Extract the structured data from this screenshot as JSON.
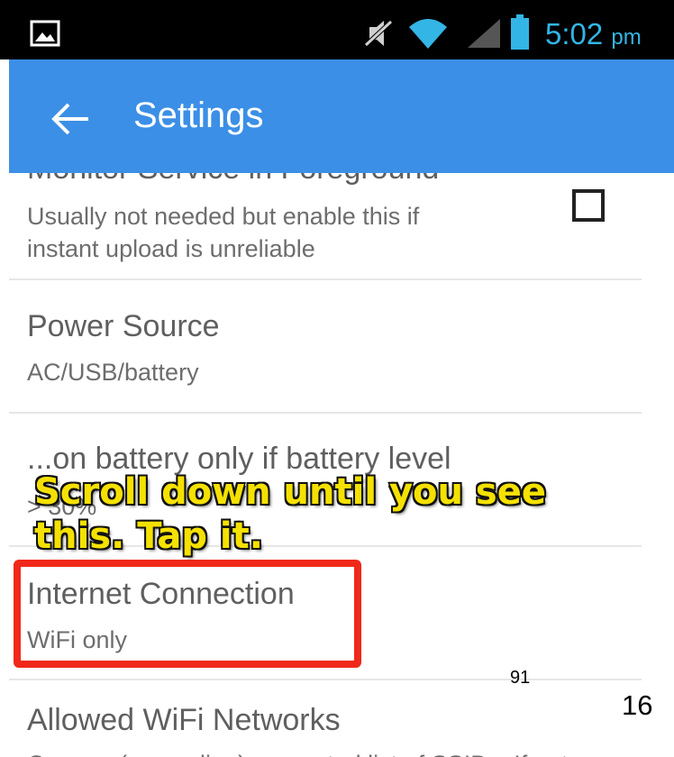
{
  "status_bar": {
    "time": "5:02",
    "ampm": "pm",
    "accent_color": "#33b5e5",
    "icons": [
      "image-notification-icon",
      "mute-icon",
      "wifi-icon",
      "signal-icon",
      "battery-icon"
    ]
  },
  "app_bar": {
    "title": "Settings",
    "color": "#3b8fe6"
  },
  "settings": {
    "monitor_service": {
      "title": "Monitor Service in Foreground",
      "summary_line1": "Usually not needed but enable this if",
      "summary_line2": "instant upload is unreliable",
      "checked": false
    },
    "power_source": {
      "title": "Power Source",
      "summary": "AC/USB/battery"
    },
    "battery_level": {
      "title": "...on battery only if battery level",
      "summary": "> 30%"
    },
    "internet_connection": {
      "title": "Internet Connection",
      "summary": "WiFi only"
    },
    "allowed_wifi": {
      "title": "Allowed WiFi Networks",
      "summary": "Comma (or newline) separated list of SSIDs. If not"
    }
  },
  "annotation": {
    "line1": "Scroll down until you see",
    "line2": "this. Tap it.",
    "highlight_color": "#f0291a"
  },
  "page_numbers": {
    "small": "91",
    "large": "16"
  }
}
